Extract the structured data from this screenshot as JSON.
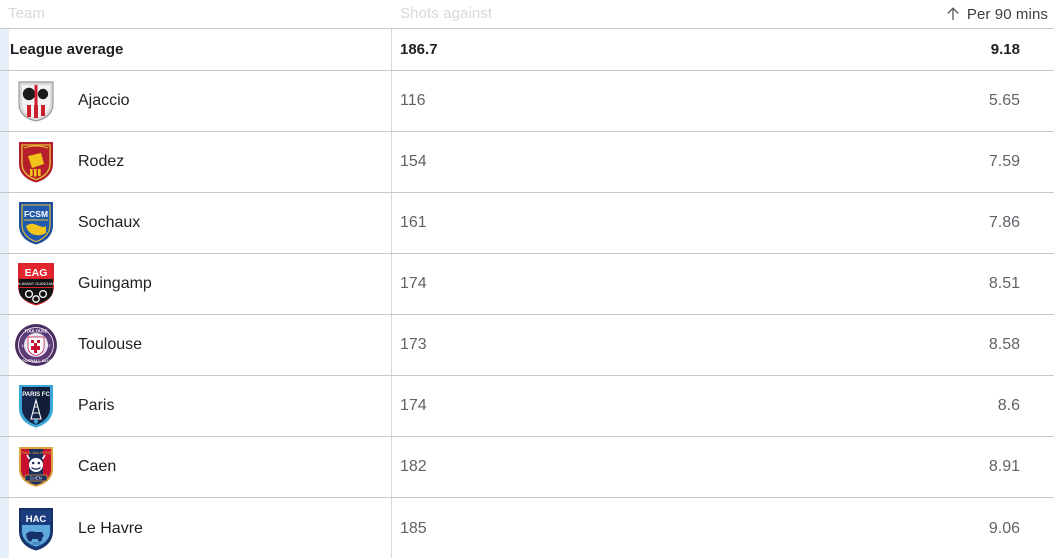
{
  "header": {
    "team_label": "Team",
    "shots_label": "Shots against",
    "per90_label": "Per 90 mins",
    "sort_icon": "arrow-up-icon",
    "sort_direction": "ascending",
    "sorted_column": "Per 90 mins"
  },
  "colors": {
    "header_text": "#d6d8de",
    "sorted_header_text": "#3c4043",
    "row_border": "#c8c8c8",
    "value_text": "#5f6368",
    "team_text": "#202124",
    "left_strip": "#e6eefa"
  },
  "league_average": {
    "label": "League average",
    "shots_against": "186.7",
    "per_90_mins": "9.18"
  },
  "rows": [
    {
      "team": "Ajaccio",
      "crest": "ajaccio-crest",
      "shots_against": "116",
      "per_90_mins": "5.65"
    },
    {
      "team": "Rodez",
      "crest": "rodez-crest",
      "shots_against": "154",
      "per_90_mins": "7.59"
    },
    {
      "team": "Sochaux",
      "crest": "sochaux-crest",
      "shots_against": "161",
      "per_90_mins": "7.86"
    },
    {
      "team": "Guingamp",
      "crest": "guingamp-crest",
      "shots_against": "174",
      "per_90_mins": "8.51"
    },
    {
      "team": "Toulouse",
      "crest": "toulouse-crest",
      "shots_against": "173",
      "per_90_mins": "8.58"
    },
    {
      "team": "Paris",
      "crest": "paris-crest",
      "shots_against": "174",
      "per_90_mins": "8.6"
    },
    {
      "team": "Caen",
      "crest": "caen-crest",
      "shots_against": "182",
      "per_90_mins": "8.91"
    },
    {
      "team": "Le Havre",
      "crest": "lehavre-crest",
      "shots_against": "185",
      "per_90_mins": "9.06"
    }
  ],
  "chart_data": {
    "type": "table",
    "title": "Shots against — Ligue 2 teams",
    "columns": [
      "Team",
      "Shots against",
      "Per 90 mins"
    ],
    "categories": [
      "League average",
      "Ajaccio",
      "Rodez",
      "Sochaux",
      "Guingamp",
      "Toulouse",
      "Paris",
      "Caen",
      "Le Havre"
    ],
    "series": [
      {
        "name": "Shots against",
        "values": [
          186.7,
          116,
          154,
          161,
          174,
          173,
          174,
          182,
          185
        ]
      },
      {
        "name": "Per 90 mins",
        "values": [
          9.18,
          5.65,
          7.59,
          7.86,
          8.51,
          8.58,
          8.6,
          8.91,
          9.06
        ]
      }
    ],
    "sorted_by": "Per 90 mins",
    "sort_order": "ascending"
  }
}
